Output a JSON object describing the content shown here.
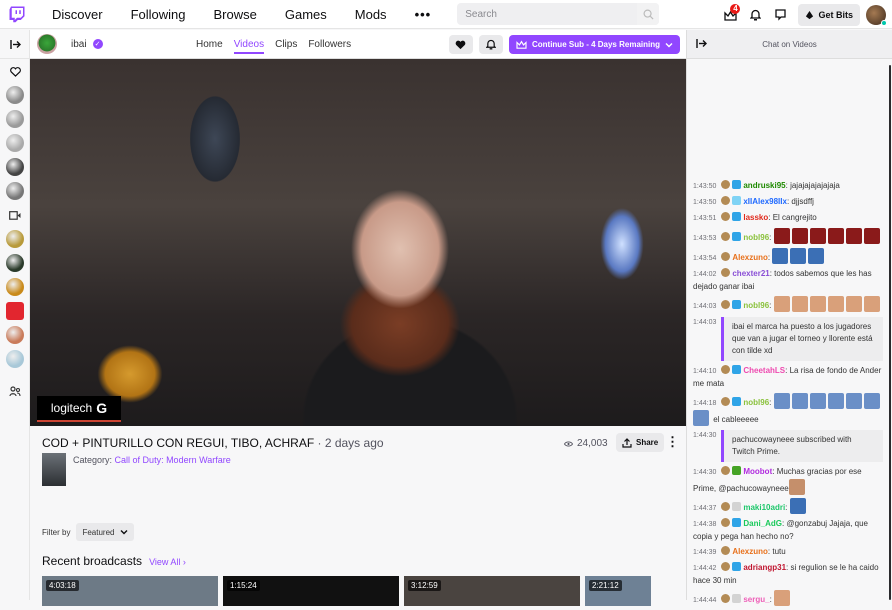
{
  "topnav": {
    "links": [
      "Discover",
      "Following",
      "Browse",
      "Games",
      "Mods"
    ],
    "more": "•••",
    "search_placeholder": "Search",
    "notifications_count": "4",
    "get_bits": "Get Bits"
  },
  "channel": {
    "name": "ibai",
    "tabs": [
      "Home",
      "Videos",
      "Clips",
      "Followers"
    ],
    "active_tab": "Videos",
    "sub_button": "Continue Sub - 4 Days Remaining"
  },
  "video": {
    "overlay_brand": "logitech",
    "title": "COD + PINTURILLO CON REGUI, TIBO, ACHRAF",
    "age": "· 2 days ago",
    "category_label": "Category:",
    "category": "Call of Duty: Modern Warfare",
    "views": "24,003",
    "share": "Share"
  },
  "filter": {
    "label": "Filter by",
    "value": "Featured"
  },
  "recent": {
    "title": "Recent broadcasts",
    "view_all": "View All",
    "thumbs": [
      {
        "duration": "4:03:18",
        "color": "#6d7a86"
      },
      {
        "duration": "1:15:24",
        "color": "#111111"
      },
      {
        "duration": "3:12:59",
        "color": "#4a4440"
      },
      {
        "duration": "2:21:12",
        "color": "#6e8195"
      }
    ]
  },
  "sidebar": {
    "avatars": [
      "#8a8a8a",
      "#9a9a9a",
      "#aaaaaa",
      "#444444",
      "#777777",
      "#b89a3a",
      "#2a3a2a",
      "#c98a1a",
      "#e2262f",
      "#c97b5a",
      "#a8c8d8"
    ]
  },
  "chat": {
    "header": "Chat on Videos",
    "messages": [
      {
        "ts": "1:43:50",
        "badge": "#2fa4e7",
        "user": "andruski95",
        "color": "#1e8a00",
        "text": "jajajajajajajaja"
      },
      {
        "ts": "1:43:50",
        "badge": "#7fd3f5",
        "user": "xIIAlex98IIx",
        "color": "#1e69ff",
        "text": "djjsdffj"
      },
      {
        "ts": "1:43:51",
        "badge": "#2fa4e7",
        "user": "lassko",
        "color": "#e0291c",
        "text": "El cangrejito"
      },
      {
        "ts": "1:43:53",
        "badge": "#2fa4e7",
        "user": "nobl96",
        "color": "#8ac13b",
        "text": "",
        "emotes": 6,
        "emote_color": "#8a1a1a"
      },
      {
        "ts": "1:43:54",
        "badge": "",
        "user": "Alexzuno",
        "color": "#e8711c",
        "text": "",
        "emotes": 3,
        "emote_color": "#3b6fb5"
      },
      {
        "ts": "1:44:02",
        "badge": "",
        "user": "chexter21",
        "color": "#8a4fd6",
        "text": "todos sabemos que les has dejado ganar ibai"
      },
      {
        "ts": "1:44:03",
        "badge": "#2fa4e7",
        "user": "nobl96",
        "color": "#8ac13b",
        "text": "",
        "emotes": 6,
        "emote_color": "#d9a07a"
      }
    ],
    "system1": {
      "ts": "1:44:03",
      "text": "ibai el marca ha puesto a los jugadores que van a jugar el torneo y llorente está con tilde xd"
    },
    "messages2": [
      {
        "ts": "1:44:10",
        "badge": "#2fa4e7",
        "user": "CheetahLS",
        "color": "#ee4ab0",
        "text": "La risa de fondo de Ander me mata"
      },
      {
        "ts": "1:44:18",
        "badge": "#2fa4e7",
        "user": "nobl96",
        "color": "#8ac13b",
        "text": "el cableeeee",
        "emotes": 7,
        "emote_color": "#6a8fc7"
      }
    ],
    "system2": {
      "ts": "1:44:30",
      "text": "pachucowayneee subscribed with Twitch Prime."
    },
    "messages3": [
      {
        "ts": "1:44:30",
        "badge": "#45a325",
        "user": "Moobot",
        "color": "#b12bdf",
        "text": "Muchas gracias por ese Prime, @pachucowayneee",
        "emotes": 1,
        "emote_color": "#c58f6b"
      },
      {
        "ts": "1:44:37",
        "badge": "#d3d3d3",
        "user": "maki10adri",
        "color": "#1ec76b",
        "text": "",
        "emotes": 1,
        "emote_color": "#3b6fb5"
      },
      {
        "ts": "1:44:38",
        "badge": "#2fa4e7",
        "user": "Dani_AdG",
        "color": "#19c95a",
        "text": "@gonzabuj Jajaja, que copia y pega han hecho no?"
      },
      {
        "ts": "1:44:39",
        "badge": "",
        "user": "Alexzuno",
        "color": "#e8711c",
        "text": "tutu"
      },
      {
        "ts": "1:44:42",
        "badge": "#2fa4e7",
        "user": "adriangp31",
        "color": "#c0152f",
        "text": "si regulion se le ha caido hace 30 min"
      },
      {
        "ts": "1:44:44",
        "badge": "#d3d3d3",
        "user": "sergu_",
        "color": "#ee5fb8",
        "text": "",
        "emotes": 1,
        "emote_color": "#d9a07a"
      }
    ]
  }
}
